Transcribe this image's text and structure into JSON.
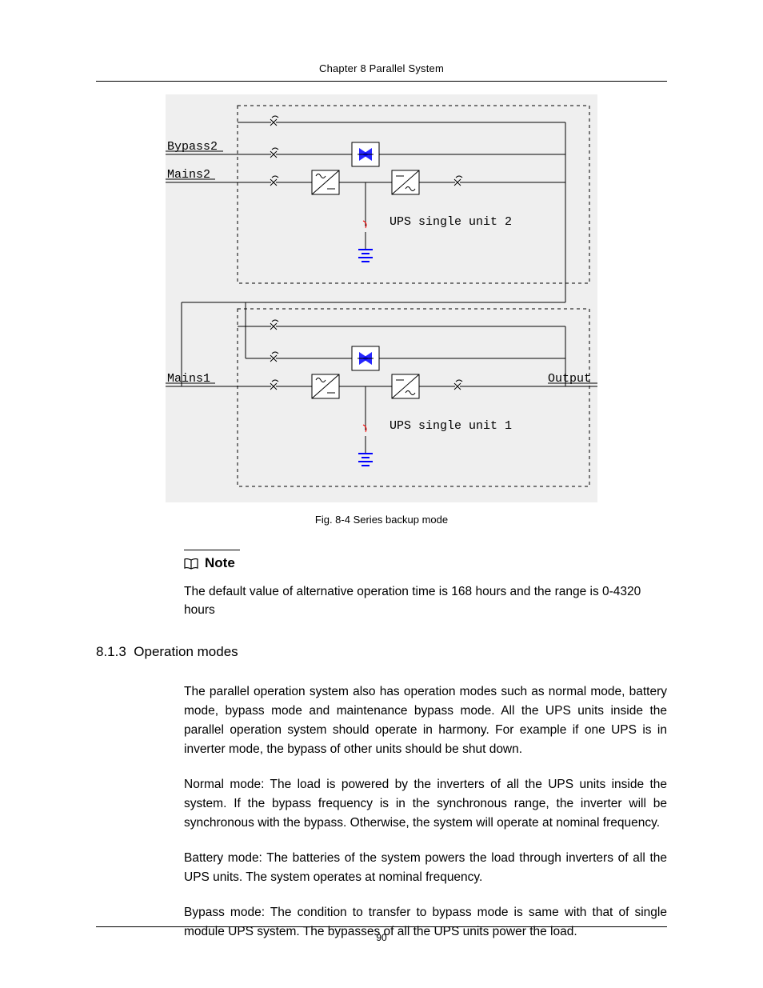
{
  "header": {
    "title": "Chapter 8  Parallel System"
  },
  "figure": {
    "caption": "Fig. 8-4 Series backup mode",
    "labels": {
      "bypass2": "Bypass2",
      "mains2": "Mains2",
      "mains1": "Mains1",
      "output": "Output",
      "unit2": "UPS single unit 2",
      "unit1": "UPS single unit 1"
    }
  },
  "note": {
    "heading": "Note",
    "text": "The default value of alternative operation time is 168 hours and the range is 0-4320 hours"
  },
  "section": {
    "number": "8.1.3",
    "title": "Operation modes",
    "paragraphs": [
      "The parallel operation system also has operation modes such as normal mode, battery mode, bypass mode and maintenance bypass mode. All the UPS units inside the parallel operation system should operate in harmony. For example if one UPS is in inverter mode, the bypass of other units should be shut down.",
      "Normal mode: The load is powered by the inverters of all the UPS units inside the system. If the bypass frequency is in the synchronous range, the inverter will be synchronous with the bypass. Otherwise, the system will operate at nominal frequency.",
      "Battery mode: The batteries of the system powers the load through inverters of all the UPS units. The system operates at nominal frequency.",
      "Bypass mode: The condition to transfer to bypass mode is same with that of single module UPS system. The bypasses of all the UPS units power the load."
    ]
  },
  "page_number": "90"
}
